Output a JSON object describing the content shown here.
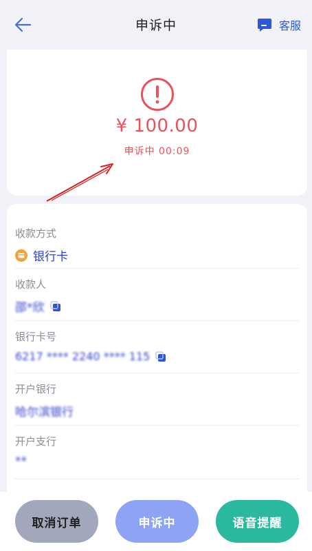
{
  "header": {
    "title": "申诉中",
    "service_label": "客服"
  },
  "order": {
    "amount": "¥ 100.00",
    "status_label": "申诉中 00:09"
  },
  "payment": {
    "method_label": "收款方式",
    "method_value": "银行卡",
    "payee_label": "收款人",
    "payee_value": "邵*欣",
    "card_number_label": "银行卡号",
    "card_number_value": "6217 **** 2240 **** 115",
    "bank_label": "开户银行",
    "bank_value": "哈尔滨银行",
    "branch_label": "开户支行",
    "branch_value": "**"
  },
  "footer": {
    "cancel_label": "取消订单",
    "appeal_label": "申诉中",
    "voice_label": "语音提醒"
  },
  "colors": {
    "accent_blue": "#2f56d8",
    "alert_red": "#e8525e",
    "teal": "#2ab89e",
    "bank_orange": "#f0a23c"
  }
}
